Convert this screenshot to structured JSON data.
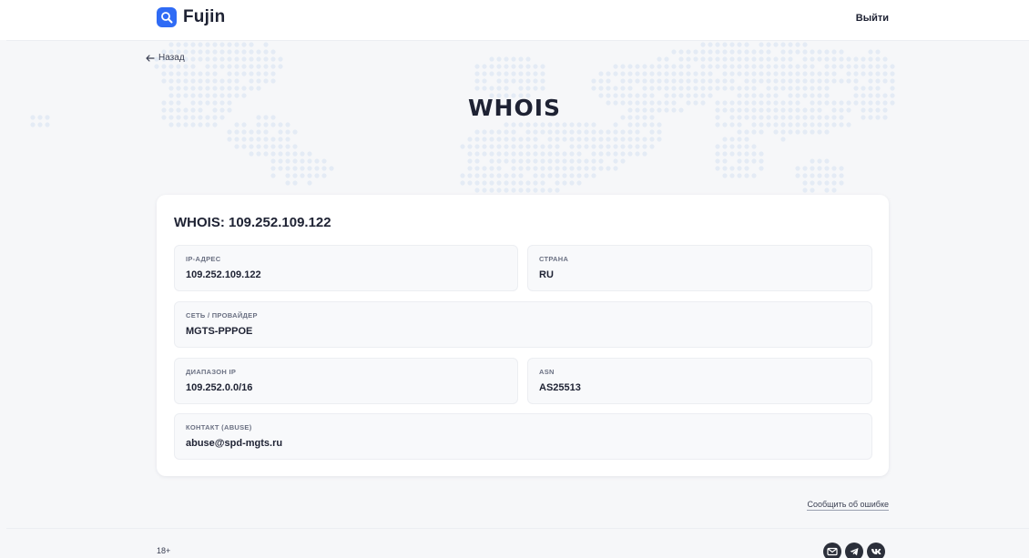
{
  "header": {
    "brand": "Fujin",
    "logout_label": "Выйти"
  },
  "hero": {
    "back_label": "Назад",
    "title": "WHOIS"
  },
  "card": {
    "title": "WHOIS: 109.252.109.122",
    "fields": [
      {
        "label": "IP-АДРЕС",
        "value": "109.252.109.122"
      },
      {
        "label": "СТРАНА",
        "value": "RU"
      },
      {
        "label": "СЕТЬ / ПРОВАЙДЕР",
        "value": "MGTS-PPPOE"
      },
      {
        "label": "ДИАПАЗОН IP",
        "value": "109.252.0.0/16"
      },
      {
        "label": "ASN",
        "value": "AS25513"
      },
      {
        "label": "КОНТАКТ (ABUSE)",
        "value": "abuse@spd-mgts.ru"
      }
    ]
  },
  "report_label": "Сообщить об ошибке",
  "footer": {
    "age_rating": "18+",
    "social_icons": [
      "mail-icon",
      "telegram-icon",
      "vk-icon"
    ]
  },
  "colors": {
    "accent": "#2f6bf5",
    "background": "#f6f7f9",
    "card": "#ffffff",
    "map_dots": "#e4ebf5"
  }
}
